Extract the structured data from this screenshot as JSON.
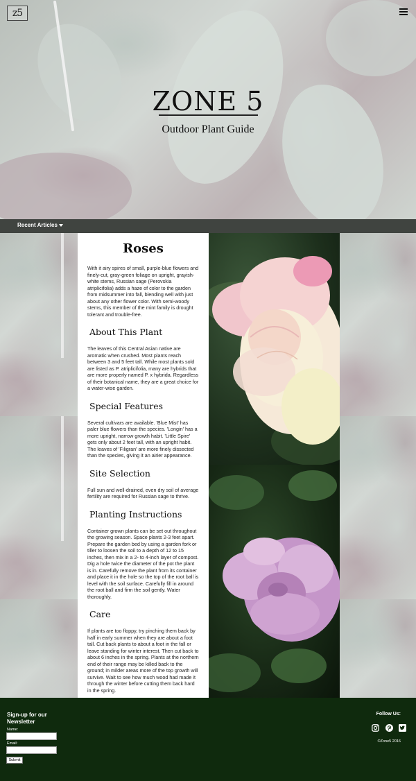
{
  "header": {
    "logo_text": "z5",
    "title": "ZONE 5",
    "subtitle": "Outdoor Plant Guide",
    "menu_icon": "hamburger-menu-icon"
  },
  "nav": {
    "recent_articles_label": "Recent Articles"
  },
  "article": {
    "title": "Roses",
    "intro": "With it airy spires of small, purple-blue flowers and finely-cut, gray-green foliage on upright, grayish-white stems, Russian sage (Perovskia atriplicifolia) adds a haze of color to the garden from midsummer into fall, blending well with just about any other flower color. With semi-woody stems, this member of the mint family is drought tolerant and trouble-free.",
    "sections": [
      {
        "heading": "About This Plant",
        "body": "The leaves of this Central Asian native are aromatic when crushed. Most plants reach between 3 and 5 feet tall. While most plants sold are listed as P. atriplicifolia, many are hybrids that are more properly named P. x hybrida. Regardless of their botanical name, they are a great choice for a water-wise garden."
      },
      {
        "heading": "Special Features",
        "body": "Several cultivars are available. 'Blue Mist' has paler blue flowers than the species. 'Longin' has a more upright, narrow growth habit. 'Little Spire' gets only about 2 feet tall, with an upright habit. The leaves of 'Filigran' are more finely dissected than the species, giving it an airier appearance."
      },
      {
        "heading": "Site Selection",
        "body": "Full sun and well-drained, even dry soil of average fertility are required for Russian sage to thrive."
      },
      {
        "heading": "Planting Instructions",
        "body": "Container grown plants can be set out throughout the growing season. Space plants 2-3 feet apart. Prepare the garden bed by using a garden fork or tiller to loosen the soil to a depth of 12 to 15 inches, then mix in a 2- to 4-inch layer of compost. Dig a hole twice the diameter of the pot the plant is in. Carefully remove the plant from its container and place it in the hole so the top of the root ball is level with the soil surface. Carefully fill in around the root ball and firm the soil gently. Water thoroughly."
      },
      {
        "heading": "Care",
        "body": "If plants are too floppy, try pinching them back by half in early summer when they are about a foot tall. Cut back plants to about a foot in the fall or leave standing for winter interest. Then cut back to about 6 inches in the spring. Plants at the northern end of their range may be killed back to the ground; in milder areas more of the top growth will survive. Wait to see how much wood had made it through the winter before cutting them back hard in the spring."
      }
    ]
  },
  "footer": {
    "signup_title": "Sign-up for our Newsletter",
    "name_label": "Name:",
    "email_label": "Email:",
    "submit_label": "Submit",
    "follow_title": "Follow Us:",
    "social_icons": [
      "instagram-icon",
      "pinterest-icon",
      "twitter-icon"
    ],
    "copyright": "©Zone5 2016"
  },
  "colors": {
    "footer_bg": "#0f2a0d",
    "bar_bg": "#282c28",
    "rose_pink": "#f3c9cf",
    "rose_lavender": "#c894c4"
  }
}
